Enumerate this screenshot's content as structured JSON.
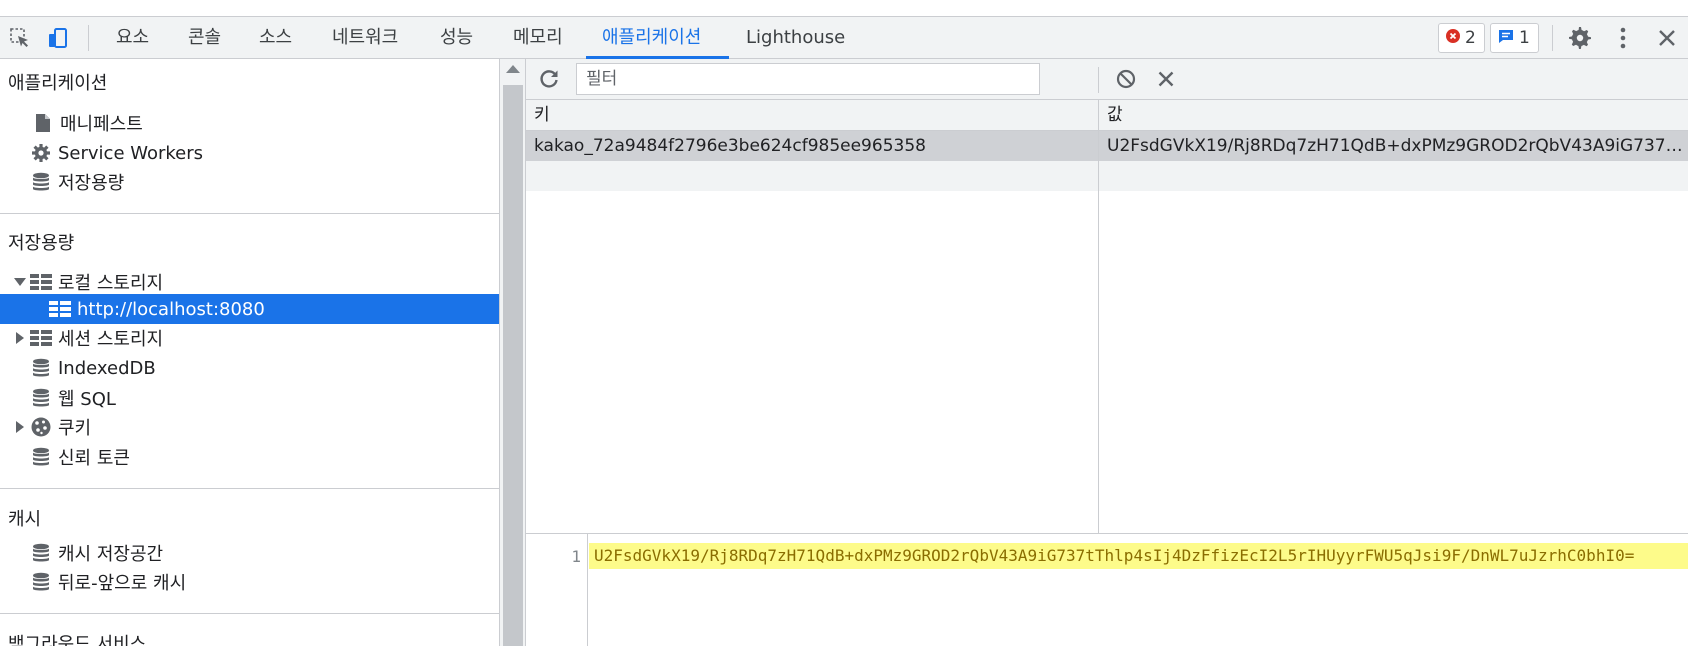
{
  "toolbar": {
    "tabs": [
      {
        "label": "요소"
      },
      {
        "label": "콘솔"
      },
      {
        "label": "소스"
      },
      {
        "label": "네트워크"
      },
      {
        "label": "성능"
      },
      {
        "label": "메모리"
      },
      {
        "label": "애플리케이션"
      },
      {
        "label": "Lighthouse"
      }
    ],
    "active_tab": "애플리케이션",
    "error_count": "2",
    "message_count": "1"
  },
  "sidebar": {
    "application": {
      "title": "애플리케이션",
      "items": [
        {
          "label": "매니페스트",
          "icon": "document-icon"
        },
        {
          "label": "Service Workers",
          "icon": "gear-icon"
        },
        {
          "label": "저장용량",
          "icon": "database-icon"
        }
      ]
    },
    "storage": {
      "title": "저장용량",
      "items": [
        {
          "label": "로컬 스토리지",
          "icon": "table-icon",
          "expanded": true
        },
        {
          "label": "http://localhost:8080",
          "icon": "table-icon",
          "selected": true
        },
        {
          "label": "세션 스토리지",
          "icon": "table-icon",
          "expanded": false
        },
        {
          "label": "IndexedDB",
          "icon": "database-icon"
        },
        {
          "label": "웹 SQL",
          "icon": "database-icon"
        },
        {
          "label": "쿠키",
          "icon": "cookie-icon",
          "expanded": false
        },
        {
          "label": "신뢰 토큰",
          "icon": "database-icon"
        }
      ]
    },
    "cache": {
      "title": "캐시",
      "items": [
        {
          "label": "캐시 저장공간",
          "icon": "database-icon"
        },
        {
          "label": "뒤로-앞으로 캐시",
          "icon": "database-icon"
        }
      ]
    },
    "background": {
      "title": "백그라운드 서비스"
    }
  },
  "storage_view": {
    "filter_placeholder": "필터",
    "columns": {
      "key": "키",
      "value": "값"
    },
    "rows": [
      {
        "key": "kakao_72a9484f2796e3be624cf985ee965358",
        "value": "U2FsdGVkX19/Rj8RDq7zH71QdB+dxPMz9GROD2rQbV43A9iG737tT..."
      }
    ],
    "preview": {
      "line_number": "1",
      "text": "U2FsdGVkX19/Rj8RDq7zH71QdB+dxPMz9GROD2rQbV43A9iG737tThlp4sIj4DzFfizEcI2L5rIHUyyrFWU5qJsi9F/DnWL7uJzrhC0bhI0="
    }
  },
  "colors": {
    "accent": "#1a73e8",
    "error": "#d93025",
    "highlight": "#fdfb8a"
  }
}
